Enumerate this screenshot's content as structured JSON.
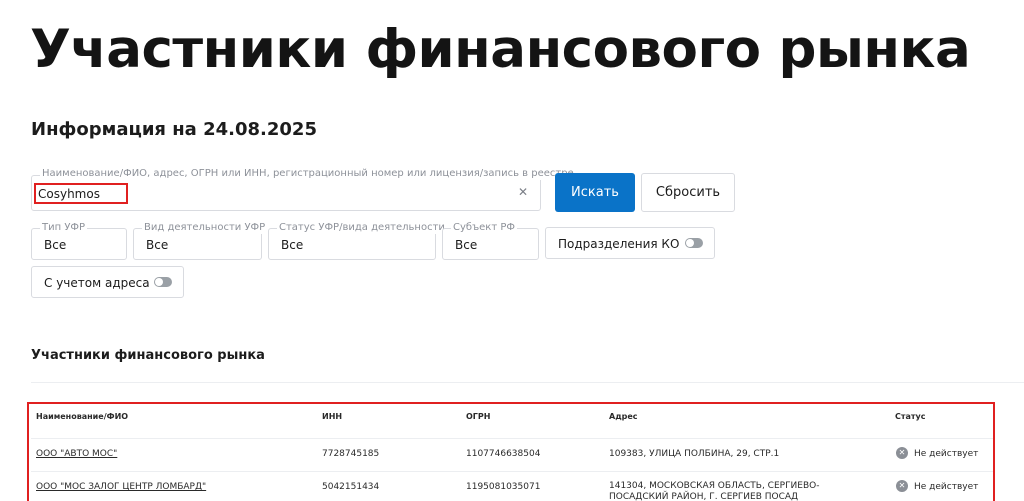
{
  "page": {
    "title": "Участники финансового рынка",
    "info_title": "Информация на 24.08.2025"
  },
  "search": {
    "label": "Наименование/ФИО, адрес, ОГРН или ИНН, регистрационный номер или лицензия/запись в реестре",
    "value": "Cosyhmos",
    "search_button": "Искать",
    "reset_button": "Сбросить"
  },
  "filters": [
    {
      "label": "Тип УФР",
      "value": "Все"
    },
    {
      "label": "Вид деятельности УФР",
      "value": "Все"
    },
    {
      "label": "Статус УФР/вида деятельности",
      "value": "Все"
    },
    {
      "label": "Субъект РФ",
      "value": "Все"
    }
  ],
  "toggles": {
    "subdivisions_label": "Подразделения КО",
    "with_address_label": "С учетом адреса"
  },
  "results": {
    "section_title": "Участники финансового рынка",
    "columns": [
      "Наименование/ФИО",
      "ИНН",
      "ОГРН",
      "Адрес",
      "Статус"
    ],
    "rows": [
      {
        "name": "ООО \"АВТО МОС\"",
        "inn": "7728745185",
        "ogrn": "1107746638504",
        "address": "109383, УЛИЦА ПОЛБИНА, 29, СТР.1",
        "status": "Не действует"
      },
      {
        "name": "ООО \"МОС ЗАЛОГ ЦЕНТР ЛОМБАРД\"",
        "inn": "5042151434",
        "ogrn": "1195081035071",
        "address": "141304, МОСКОВСКАЯ ОБЛАСТЬ, СЕРГИЕВО-",
        "address_line2": "ПОСАДСКИЙ РАЙОН, Г. СЕРГИЕВ ПОСАД",
        "status": "Не действует"
      }
    ]
  },
  "icons": {
    "clear": "close-icon",
    "status": "status-inactive-icon"
  },
  "colors": {
    "primary_button": "#0a73c8",
    "highlight_border": "#e02020",
    "status_icon": "#8b8f96"
  }
}
